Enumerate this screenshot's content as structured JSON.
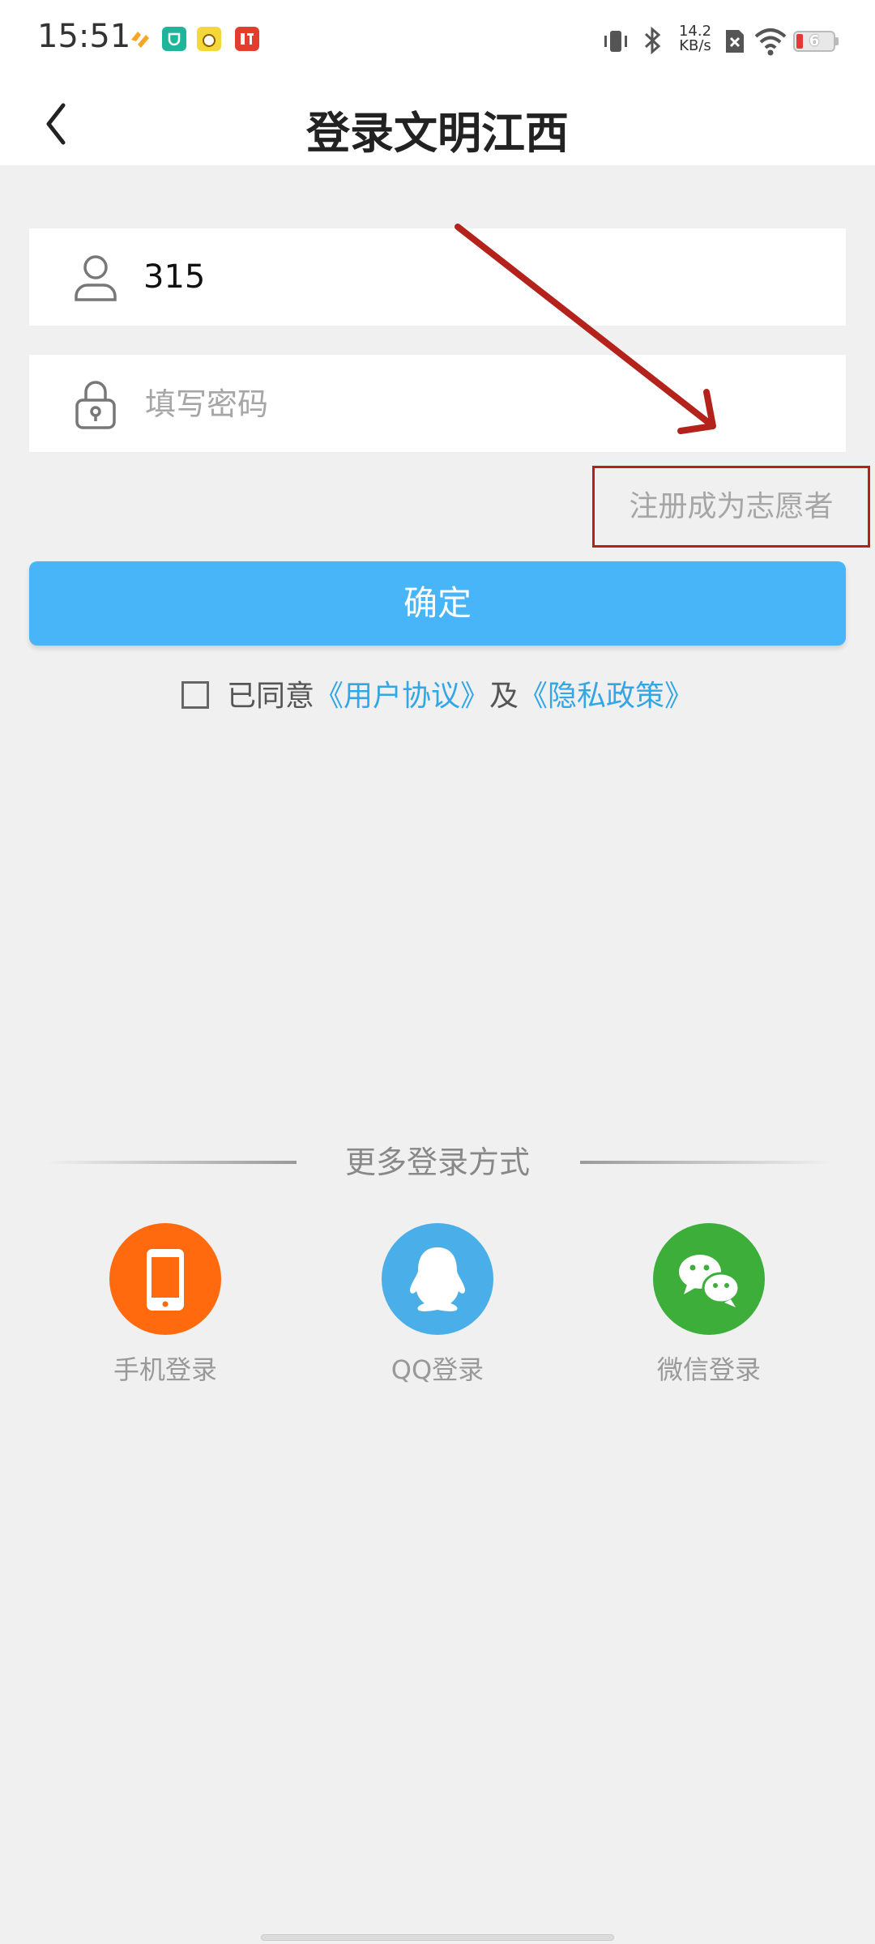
{
  "status_bar": {
    "time": "15:51",
    "net_speed_value": "14.2",
    "net_speed_unit": "KB/s",
    "battery_level": "6",
    "app_badge_colors": [
      "#f5a623",
      "#1fb59b",
      "#f4d83a",
      "#e23d2d"
    ]
  },
  "header": {
    "title": "登录文明江西",
    "back_icon": "chevron-left-icon"
  },
  "form": {
    "username_value": "315",
    "password_placeholder": "填写密码",
    "register_link": "注册成为志愿者",
    "confirm_label": "确定"
  },
  "agreement": {
    "prefix": "已同意",
    "user_agreement": "《用户协议》",
    "and": "及",
    "privacy_policy": "《隐私政策》",
    "checked": false
  },
  "more_login": {
    "label": "更多登录方式",
    "options": [
      {
        "label": "手机登录",
        "icon": "phone-icon",
        "color": "#ff6a0f"
      },
      {
        "label": "QQ登录",
        "icon": "qq-icon",
        "color": "#4aaee8"
      },
      {
        "label": "微信登录",
        "icon": "wechat-icon",
        "color": "#3dae3a"
      }
    ]
  },
  "colors": {
    "accent": "#47b5f7",
    "link": "#33a7e6",
    "annotation_red": "#b3221b",
    "background": "#f0f0f0"
  }
}
